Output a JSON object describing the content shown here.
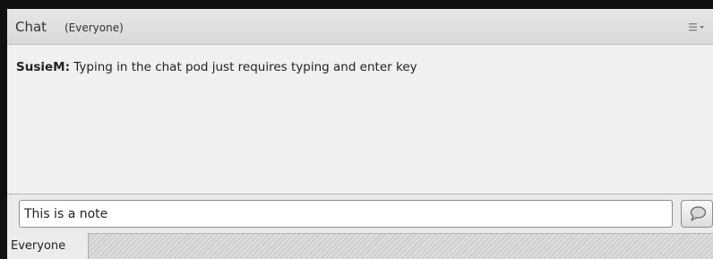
{
  "header": {
    "title": "Chat",
    "subtitle": "(Everyone)",
    "menu_icon": "list-menu-icon"
  },
  "messages": [
    {
      "sender": "SusieM:",
      "text": " Typing in the chat pod just requires typing and enter key"
    }
  ],
  "composer": {
    "value": "This is a note",
    "send_icon": "speech-bubble-icon"
  },
  "tabs": [
    {
      "label": "Everyone",
      "active": true
    }
  ],
  "colors": {
    "pod_background": "#f0f0f0",
    "header_background": "#dedede",
    "frame_border": "#111111"
  }
}
